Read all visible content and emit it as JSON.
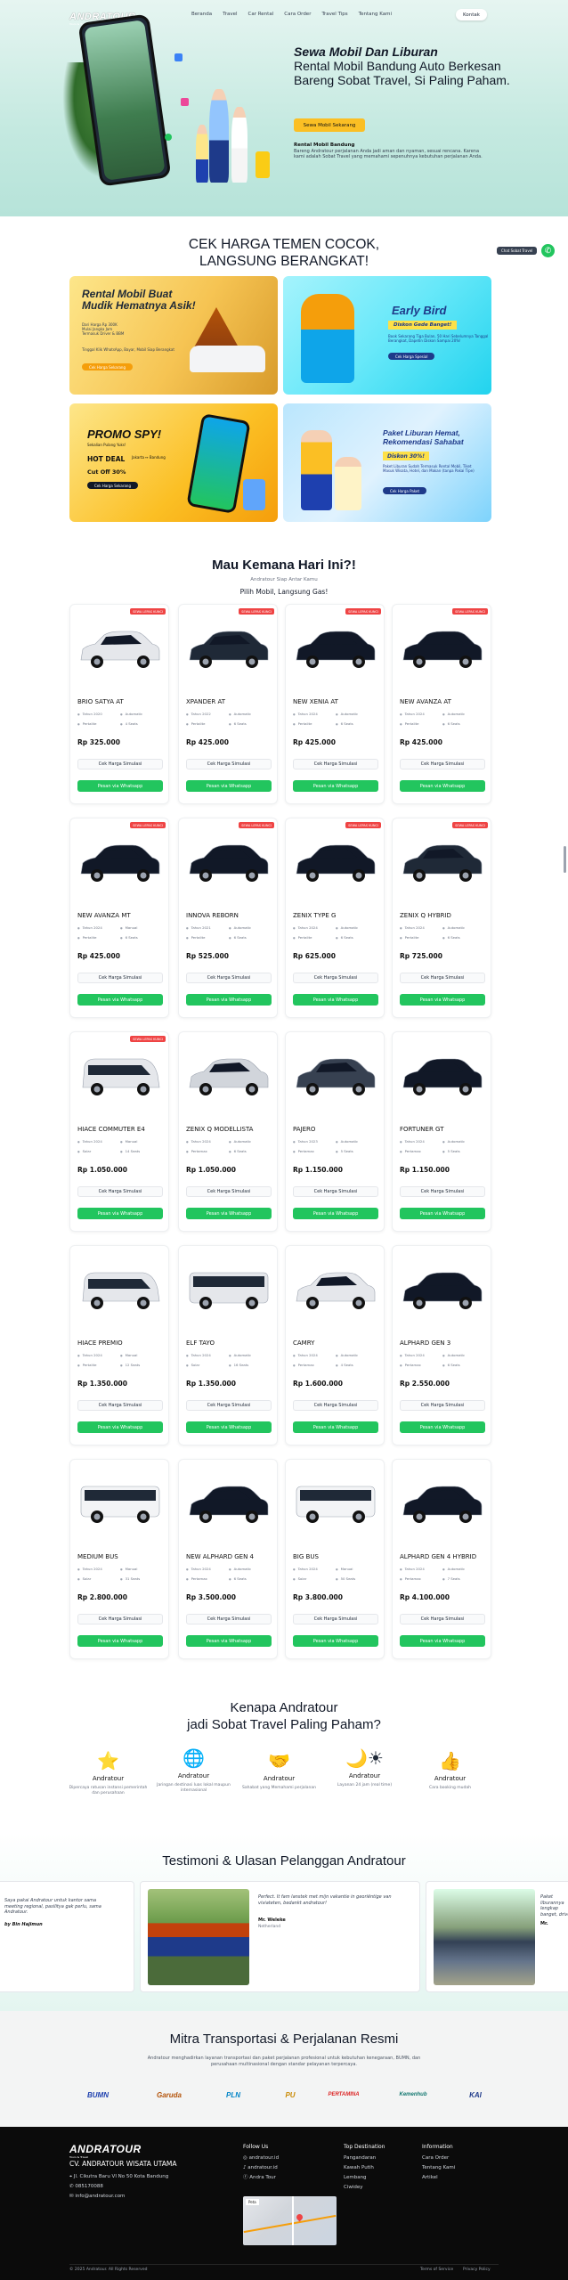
{
  "brand": {
    "name": "ANDRATOUR",
    "tagline": "Tours & Travel"
  },
  "nav": {
    "items": [
      "Beranda",
      "Travel",
      "Car Rental",
      "Cara Order",
      "Travel Tips",
      "Tentang Kami"
    ],
    "contact": "Kontak"
  },
  "hero": {
    "title_italic": "Sewa Mobil Dan Liburan",
    "title_rest": "Rental Mobil Bandung Auto Berkesan Bareng Sobat Travel, Si Paling Paham.",
    "cta": "Sewa Mobil Sekarang",
    "sub_title": "Rental Mobil Bandung",
    "sub_text": "Bareng Andratour perjalanan Anda jadi aman dan nyaman, sesuai rencana. Karena kami adalah Sobat Travel yang memahami sepenuhnya kebutuhan perjalanan Anda."
  },
  "floating": {
    "label": "Chat Sobat Travel"
  },
  "promos_section": {
    "title_line1": "CEK HARGA TEMEN COCOK,",
    "title_line2": "LANGSUNG BERANGKAT!"
  },
  "promos": [
    {
      "title": "Rental Mobil Buat Mudik Hematnya Asik!",
      "lines": [
        "Dari Harga Rp 300K",
        "Mulai Jangka Jam",
        "Termasuk Driver & BBM"
      ],
      "button": "Cek Harga Sekarang",
      "note": "Tinggal Klik WhatsApp, Bayar, Mobil Siap Berangkat"
    },
    {
      "title": "Early Bird",
      "subtitle": "Diskon Gede Banget!",
      "lines": [
        "Book Sekarang Tiga Bulan, 50 Hari Sebelumnya Tanggal",
        "Berangkat, Dapetin Diskon Sampai 20%!"
      ],
      "button": "Cek Harga Spesial"
    },
    {
      "title": "PROMO SPY!",
      "subtitle": "Sekalian Pulang Yuks!",
      "lines": [
        "HOT DEAL",
        "Jakarta ↔ Bandung",
        "Cut Off 30%"
      ],
      "button": "Cek Harga Sekarang"
    },
    {
      "title": "Paket Liburan Hemat, Rekomendasi Sahabat",
      "subtitle": "Diskon 30%!",
      "lines": [
        "Paket Liburan Sudah Termasuk Rental Mobil, Tiket",
        "Masuk Wisata, Hotel, dan Makan (tanpa Pakai Tipe)"
      ],
      "button": "Cek Harga Paket"
    }
  ],
  "cars_section": {
    "title": "Mau Kemana Hari Ini?!",
    "subtitle": "Andratour Siap Antar Kamu",
    "subtitle2": "Pilih Mobil, Langsung Gas!"
  },
  "cars": [
    {
      "name": "BRIO SATYA AT",
      "year": "Tahun 2020",
      "trans": "Automatic",
      "fuel": "Pertalite",
      "seats": "4 Seats",
      "price": "Rp 325.000",
      "badge": "SEWA LEPAS KUNCI",
      "color": "#e5e7eb"
    },
    {
      "name": "XPANDER AT",
      "year": "Tahun 2022",
      "trans": "Automatic",
      "fuel": "Pertalite",
      "seats": "6 Seats",
      "price": "Rp 425.000",
      "badge": "SEWA LEPAS KUNCI",
      "color": "#1f2937"
    },
    {
      "name": "NEW XENIA AT",
      "year": "Tahun 2024",
      "trans": "Automatic",
      "fuel": "Pertalite",
      "seats": "6 Seats",
      "price": "Rp 425.000",
      "badge": "SEWA LEPAS KUNCI",
      "color": "#111827"
    },
    {
      "name": "NEW AVANZA AT",
      "year": "Tahun 2024",
      "trans": "Automatic",
      "fuel": "Pertalite",
      "seats": "6 Seats",
      "price": "Rp 425.000",
      "badge": "SEWA LEPAS KUNCI",
      "color": "#111827"
    },
    {
      "name": "NEW AVANZA MT",
      "year": "Tahun 2024",
      "trans": "Manual",
      "fuel": "Pertalite",
      "seats": "6 Seats",
      "price": "Rp 425.000",
      "badge": "SEWA LEPAS KUNCI",
      "color": "#111827"
    },
    {
      "name": "INNOVA REBORN",
      "year": "Tahun 2021",
      "trans": "Automatic",
      "fuel": "Pertalite",
      "seats": "6 Seats",
      "price": "Rp 525.000",
      "badge": "SEWA LEPAS KUNCI",
      "color": "#111827"
    },
    {
      "name": "ZENIX TYPE G",
      "year": "Tahun 2024",
      "trans": "Automatic",
      "fuel": "Pertalite",
      "seats": "6 Seats",
      "price": "Rp 625.000",
      "badge": "SEWA LEPAS KUNCI",
      "color": "#111827"
    },
    {
      "name": "ZENIX Q HYBRID",
      "year": "Tahun 2024",
      "trans": "Automatic",
      "fuel": "Pertalite",
      "seats": "6 Seats",
      "price": "Rp 725.000",
      "badge": "SEWA LEPAS KUNCI",
      "color": "#1f2937"
    },
    {
      "name": "HIACE COMMUTER E4",
      "year": "Tahun 2024",
      "trans": "Manual",
      "fuel": "Solar",
      "seats": "14 Seats",
      "price": "Rp 1.050.000",
      "badge": "SEWA LEPAS KUNCI",
      "color": "#e5e7eb"
    },
    {
      "name": "ZENIX Q MODELLISTA",
      "year": "Tahun 2024",
      "trans": "Automatic",
      "fuel": "Pertamax",
      "seats": "6 Seats",
      "price": "Rp 1.050.000",
      "badge": "",
      "color": "#d1d5db"
    },
    {
      "name": "PAJERO",
      "year": "Tahun 2023",
      "trans": "Automatic",
      "fuel": "Pertamax",
      "seats": "5 Seats",
      "price": "Rp 1.150.000",
      "badge": "",
      "color": "#374151"
    },
    {
      "name": "FORTUNER GT",
      "year": "Tahun 2024",
      "trans": "Automatic",
      "fuel": "Pertamax",
      "seats": "5 Seats",
      "price": "Rp 1.150.000",
      "badge": "",
      "color": "#111827"
    },
    {
      "name": "HIACE PREMIO",
      "year": "Tahun 2024",
      "trans": "Manual",
      "fuel": "Pertalite",
      "seats": "12 Seats",
      "price": "Rp 1.350.000",
      "badge": "",
      "color": "#e5e7eb"
    },
    {
      "name": "ELF TAYO",
      "year": "Tahun 2024",
      "trans": "Automatic",
      "fuel": "Solar",
      "seats": "16 Seats",
      "price": "Rp 1.350.000",
      "badge": "",
      "color": "#e5e7eb"
    },
    {
      "name": "CAMRY",
      "year": "Tahun 2024",
      "trans": "Automatic",
      "fuel": "Pertamax",
      "seats": "4 Seats",
      "price": "Rp 1.600.000",
      "badge": "",
      "color": "#e5e7eb"
    },
    {
      "name": "ALPHARD GEN 3",
      "year": "Tahun 2024",
      "trans": "Automatic",
      "fuel": "Pertamax",
      "seats": "6 Seats",
      "price": "Rp 2.550.000",
      "badge": "",
      "color": "#111827"
    },
    {
      "name": "MEDIUM BUS",
      "year": "Tahun 2024",
      "trans": "Manual",
      "fuel": "Solar",
      "seats": "31 Seats",
      "price": "Rp 2.800.000",
      "badge": "",
      "color": "#f3f4f6"
    },
    {
      "name": "NEW ALPHARD GEN 4",
      "year": "Tahun 2024",
      "trans": "Automatic",
      "fuel": "Pertamax",
      "seats": "6 Seats",
      "price": "Rp 3.500.000",
      "badge": "",
      "color": "#111827"
    },
    {
      "name": "BIG BUS",
      "year": "Tahun 2024",
      "trans": "Manual",
      "fuel": "Solar",
      "seats": "50 Seats",
      "price": "Rp 3.800.000",
      "badge": "",
      "color": "#f3f4f6"
    },
    {
      "name": "ALPHARD GEN 4 HYBRID",
      "year": "Tahun 2024",
      "trans": "Automatic",
      "fuel": "Pertamax",
      "seats": "7 Seats",
      "price": "Rp 4.100.000",
      "badge": "",
      "color": "#111827"
    }
  ],
  "card_labels": {
    "check": "Cek Harga Simulasi",
    "order": "Pesan via Whatsapp"
  },
  "why": {
    "title_line1": "Kenapa Andratour",
    "title_line2": "jadi Sobat Travel Paling Paham?",
    "items": [
      {
        "icon": "star-icon",
        "glyph": "⭐",
        "name": "Andratour",
        "desc": "Dipercaya ratusan instansi pemerintah dan perusahaan"
      },
      {
        "icon": "globe-icon",
        "glyph": "🌐",
        "name": "Andratour",
        "desc": "Jaringan destinasi luas lokal maupun internasional"
      },
      {
        "icon": "handshake-icon",
        "glyph": "🤝",
        "name": "Andratour",
        "desc": "Sahabat yang Memahami perjalanan"
      },
      {
        "icon": "day-night-icon",
        "glyph": "🌙☀",
        "name": "Andratour",
        "desc": "Layanan 24 jam (real time)"
      },
      {
        "icon": "thumbs-up-icon",
        "glyph": "👍",
        "name": "Andratour",
        "desc": "Cara booking mudah"
      }
    ]
  },
  "testimonials": {
    "title": "Testimoni & Ulasan Pelanggan Andratour",
    "items": [
      {
        "text": "Saya pakai Andratour untuk kantor sama meeting regional, pasilitya gak perlu, sama Andratour.",
        "author": "by Bin Hajimun",
        "origin": ""
      },
      {
        "text": "Perfect. It fam lanstek met mijn vakantie in georiëntige van viviateten, bedankt andratour!",
        "author": "Mr. Weleke",
        "origin": "Netherland"
      },
      {
        "text": "Paket liburannya lengkap banget, driver ramah dan tepat waktu.",
        "author": "Mr.",
        "origin": ""
      }
    ]
  },
  "partners": {
    "title": "Mitra Transportasi & Perjalanan Resmi",
    "desc": "Andratour menghadirkan layanan transportasi dan paket perjalanan profesional untuk kebutuhan kenegaraan, BUMN, dan perusahaan multinasional dengan standar pelayanan terpercaya.",
    "logos": [
      "BUMN",
      "Garuda",
      "PLN",
      "PU",
      "PERTAMINA",
      "Kemenhub",
      "KAI"
    ]
  },
  "footer": {
    "company": "CV. ANDRATOUR WISATA UTAMA",
    "address": "Jl. Cikutra Baru VI No 50 Kota Bandung",
    "phone": "085170088",
    "email": "info@andratour.com",
    "follow_title": "Follow Us",
    "follow": [
      "andratour.id",
      "andratour.id",
      "Andra Tour"
    ],
    "map_label": "Peta",
    "dest_title": "Top Destination",
    "dest": [
      "Pangandaran",
      "Kawah Putih",
      "Lembang",
      "Ciwidey"
    ],
    "info_title": "Information",
    "info": [
      "Cara Order",
      "Tentang Kami",
      "Artikel"
    ],
    "copyright": "© 2025 Andratour. All Rights Reserved",
    "terms": "Terms of Service",
    "privacy": "Privacy Policy"
  }
}
